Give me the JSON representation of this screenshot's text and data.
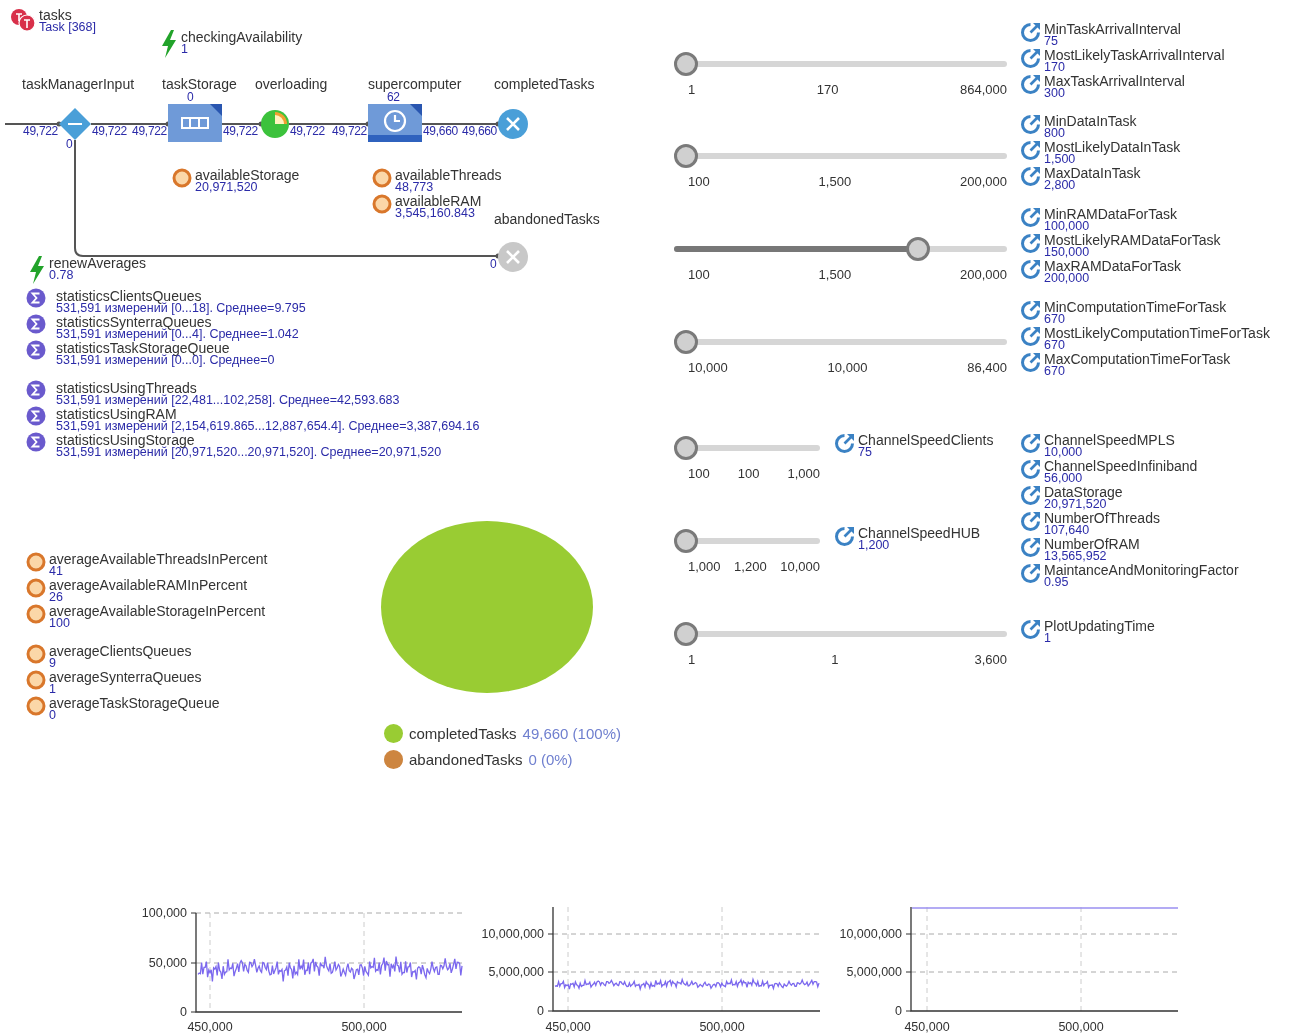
{
  "flowchart": {
    "population": {
      "name": "tasks",
      "value": "Task [368]"
    },
    "event": {
      "name": "checkingAvailability",
      "value": "1"
    },
    "blocks": [
      {
        "kind": "select",
        "name": "taskManagerInput",
        "in": "49,722",
        "out": "49,722",
        "out_alt": "0"
      },
      {
        "kind": "queue",
        "name": "taskStorage",
        "count": "0",
        "in": "49,722",
        "out": "49,722"
      },
      {
        "kind": "hold",
        "name": "overloading",
        "out": "49,722"
      },
      {
        "kind": "delay",
        "name": "supercomputer",
        "count": "62",
        "in": "49,722",
        "out": "49,660"
      },
      {
        "kind": "sink",
        "name": "completedTasks",
        "in": "49,660"
      }
    ],
    "abandoned": {
      "name": "abandonedTasks",
      "in": "0"
    },
    "variables": [
      {
        "name": "availableStorage",
        "value": "20,971,520"
      },
      {
        "name": "availableThreads",
        "value": "48,773"
      },
      {
        "name": "availableRAM",
        "value": "3,545,160.843"
      }
    ]
  },
  "renew_event": {
    "name": "renewAverages",
    "value": "0.78"
  },
  "statistics": [
    {
      "name": "statisticsClientsQueues",
      "value": "531,591 измерений [0...18]. Среднее=9.795"
    },
    {
      "name": "statisticsSynterraQueues",
      "value": "531,591 измерений [0...4]. Среднее=1.042"
    },
    {
      "name": "statisticsTaskStorageQueue",
      "value": "531,591 измерений [0...0]. Среднее=0"
    },
    {
      "name": "statisticsUsingThreads",
      "value": "531,591 измерений [22,481...102,258]. Среднее=42,593.683"
    },
    {
      "name": "statisticsUsingRAM",
      "value": "531,591 измерений [2,154,619.865...12,887,654.4]. Среднее=3,387,694.16"
    },
    {
      "name": "statisticsUsingStorage",
      "value": "531,591 измерений [20,971,520...20,971,520]. Среднее=20,971,520"
    }
  ],
  "averages": [
    {
      "name": "averageAvailableThreadsInPercent",
      "value": "41"
    },
    {
      "name": "averageAvailableRAMInPercent",
      "value": "26"
    },
    {
      "name": "averageAvailableStorageInPercent",
      "value": "100"
    },
    {
      "name": "averageClientsQueues",
      "value": "9"
    },
    {
      "name": "averageSynterraQueues",
      "value": "1"
    },
    {
      "name": "averageTaskStorageQueue",
      "value": "0"
    }
  ],
  "pie": {
    "chart_data": {
      "type": "pie",
      "categories": [
        "completedTasks",
        "abandonedTasks"
      ],
      "values": [
        100,
        0
      ]
    },
    "legend": [
      {
        "value": "49,660 (100%)",
        "color": "#99cc33"
      },
      {
        "value": "0 (0%)",
        "color": "#cd853f"
      }
    ]
  },
  "slider_groups": [
    {
      "level": 0,
      "ticks": [
        "1",
        "170",
        "864,000"
      ],
      "parameters": [
        {
          "name": "MinTaskArrivalInterval",
          "value": "75"
        },
        {
          "name": "MostLikelyTaskArrivalInterval",
          "value": "170"
        },
        {
          "name": "MaxTaskArrivalInterval",
          "value": "300"
        }
      ]
    },
    {
      "level": 0,
      "ticks": [
        "100",
        "1,500",
        "200,000"
      ],
      "parameters": [
        {
          "name": "MinDataInTask",
          "value": "800"
        },
        {
          "name": "MostLikelyDataInTask",
          "value": "1,500"
        },
        {
          "name": "MaxDataInTask",
          "value": "2,800"
        }
      ]
    },
    {
      "level": 0.75,
      "ticks": [
        "100",
        "1,500",
        "200,000"
      ],
      "parameters": [
        {
          "name": "MinRAMDataForTask",
          "value": "100,000"
        },
        {
          "name": "MostLikelyRAMDataForTask",
          "value": "150,000"
        },
        {
          "name": "MaxRAMDataForTask",
          "value": "200,000"
        }
      ]
    },
    {
      "level": 0,
      "ticks": [
        "10,000",
        "10,000",
        "86,400"
      ],
      "parameters": [
        {
          "name": "MinComputationTimeForTask",
          "value": "670"
        },
        {
          "name": "MostLikelyComputationTimeForTask",
          "value": "670"
        },
        {
          "name": "MaxComputationTimeForTask",
          "value": "670"
        }
      ]
    },
    {
      "level": 0,
      "ticks": [
        "1",
        "1",
        "3,600"
      ],
      "parameters": [
        {
          "name": "PlotUpdatingTime",
          "value": "1"
        }
      ]
    }
  ],
  "short_sliders": [
    {
      "level": 0,
      "ticks": [
        "100",
        "100",
        "1,000"
      ],
      "parameter": {
        "name": "ChannelSpeedClients",
        "value": "75"
      }
    },
    {
      "level": 0,
      "ticks": [
        "1,000",
        "1,200",
        "10,000"
      ],
      "parameter": {
        "name": "ChannelSpeedHUB",
        "value": "1,200"
      }
    }
  ],
  "parameters": [
    {
      "name": "ChannelSpeedMPLS",
      "value": "10,000"
    },
    {
      "name": "ChannelSpeedInfiniband",
      "value": "56,000"
    },
    {
      "name": "DataStorage",
      "value": "20,971,520"
    },
    {
      "name": "NumberOfThreads",
      "value": "107,640"
    },
    {
      "name": "NumberOfRAM",
      "value": "13,565,952"
    },
    {
      "name": "MaintanceAndMonitoringFactor",
      "value": "0.95"
    }
  ],
  "time_plots": [
    {
      "kind": "noisy",
      "y_ticks": [
        "100,000",
        "50,000",
        "0"
      ],
      "x_ticks": [
        "450,000",
        "500,000"
      ]
    },
    {
      "kind": "noisy",
      "y_ticks": [
        "10,000,000",
        "5,000,000",
        "0"
      ],
      "x_ticks": [
        "450,000",
        "500,000"
      ]
    },
    {
      "kind": "flat",
      "y_ticks": [
        "10,000,000",
        "5,000,000",
        "0"
      ],
      "x_ticks": [
        "450,000",
        "500,000"
      ]
    }
  ]
}
